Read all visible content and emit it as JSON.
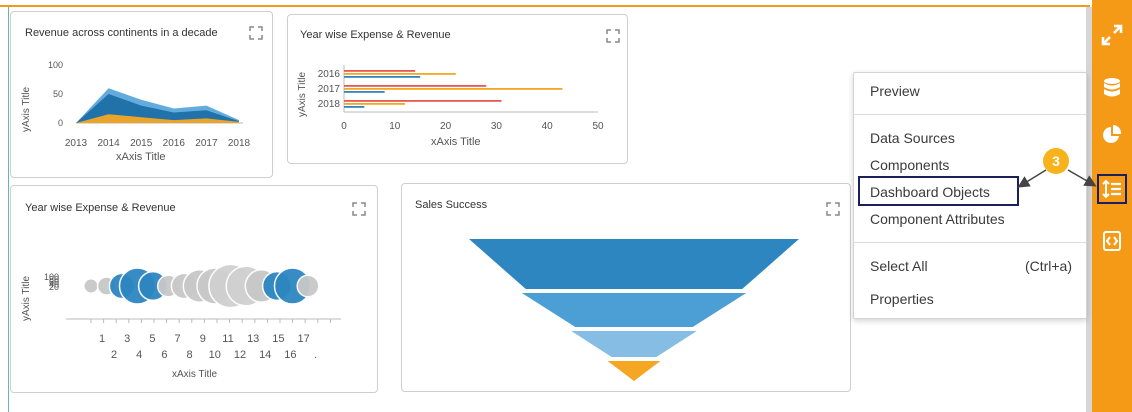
{
  "panels": {
    "revenue_continents": {
      "title": "Revenue across continents in a decade",
      "ylabel": "yAxis Title",
      "xlabel": "xAxis Title",
      "y_ticks": [
        "100",
        "50",
        "0"
      ],
      "x_ticks": [
        "2013",
        "2014",
        "2015",
        "2016",
        "2017",
        "2018"
      ]
    },
    "expense_revenue_bar": {
      "title": "Year wise Expense & Revenue",
      "ylabel": "yAxis Title",
      "xlabel": "xAxis Title",
      "y_ticks": [
        "2016",
        "2017",
        "2018"
      ],
      "x_ticks": [
        "0",
        "10",
        "20",
        "30",
        "40",
        "50"
      ]
    },
    "expense_revenue_bubble": {
      "title": "Year wise Expense & Revenue",
      "ylabel": "yAxis Title",
      "xlabel": "xAxis Title",
      "y_ticks": [
        "100",
        "80",
        "60",
        "40",
        "20"
      ],
      "x_ticks_top": [
        "1",
        "3",
        "5",
        "7",
        "9",
        "11",
        "13",
        "15",
        "17"
      ],
      "x_ticks_bottom": [
        "2",
        "4",
        "6",
        "8",
        "10",
        "12",
        "14",
        "16",
        "."
      ]
    },
    "sales_success": {
      "title": "Sales Success"
    }
  },
  "chart_data": [
    {
      "type": "area",
      "title": "Revenue across continents in a decade",
      "xlabel": "xAxis Title",
      "ylabel": "yAxis Title",
      "x": [
        2013,
        2014,
        2015,
        2016,
        2017,
        2018
      ],
      "ylim": [
        0,
        100
      ],
      "series": [
        {
          "values": [
            0,
            60,
            40,
            25,
            30,
            5
          ],
          "color": "#5aa6dd"
        },
        {
          "values": [
            0,
            50,
            30,
            18,
            22,
            3
          ],
          "color": "#1f6fa6"
        },
        {
          "values": [
            0,
            15,
            10,
            5,
            8,
            2
          ],
          "color": "#f5a623"
        }
      ]
    },
    {
      "type": "bar",
      "orientation": "horizontal",
      "title": "Year wise Expense & Revenue",
      "xlabel": "xAxis Title",
      "ylabel": "yAxis Title",
      "categories": [
        "2016",
        "2017",
        "2018"
      ],
      "xlim": [
        0,
        50
      ],
      "series": [
        {
          "values": [
            14,
            28,
            31
          ],
          "color": "#e8584f"
        },
        {
          "values": [
            22,
            43,
            12
          ],
          "color": "#f5a623"
        },
        {
          "values": [
            15,
            8,
            4
          ],
          "color": "#2e86c1"
        }
      ]
    },
    {
      "type": "scatter",
      "title": "Year wise Expense & Revenue",
      "xlabel": "xAxis Title",
      "ylabel": "yAxis Title",
      "ylim": [
        20,
        100
      ],
      "points": [
        {
          "x": 1,
          "y": 60,
          "size": 8,
          "color": "#c8c8c8"
        },
        {
          "x": 2,
          "y": 60,
          "size": 10,
          "color": "#c8c8c8"
        },
        {
          "x": 3,
          "y": 60,
          "size": 14,
          "color": "#2e86c1"
        },
        {
          "x": 4,
          "y": 60,
          "size": 20,
          "color": "#2e86c1"
        },
        {
          "x": 5,
          "y": 60,
          "size": 16,
          "color": "#2e86c1"
        },
        {
          "x": 6,
          "y": 60,
          "size": 12,
          "color": "#c8c8c8"
        },
        {
          "x": 7,
          "y": 60,
          "size": 14,
          "color": "#c8c8c8"
        },
        {
          "x": 8,
          "y": 60,
          "size": 18,
          "color": "#c8c8c8"
        },
        {
          "x": 9,
          "y": 60,
          "size": 20,
          "color": "#c8c8c8"
        },
        {
          "x": 10,
          "y": 60,
          "size": 24,
          "color": "#d0d0d0"
        },
        {
          "x": 11,
          "y": 60,
          "size": 22,
          "color": "#d0d0d0"
        },
        {
          "x": 12,
          "y": 60,
          "size": 18,
          "color": "#c8c8c8"
        },
        {
          "x": 13,
          "y": 60,
          "size": 16,
          "color": "#2e86c1"
        },
        {
          "x": 14,
          "y": 60,
          "size": 20,
          "color": "#2e86c1"
        },
        {
          "x": 15,
          "y": 60,
          "size": 12,
          "color": "#c8c8c8"
        }
      ]
    },
    {
      "type": "funnel",
      "title": "Sales Success",
      "stages": [
        {
          "value": 100,
          "color": "#2e86c1"
        },
        {
          "value": 68,
          "color": "#4c9fd4"
        },
        {
          "value": 38,
          "color": "#85bde4"
        },
        {
          "value": 16,
          "color": "#f5a623"
        }
      ]
    }
  ],
  "context_menu": {
    "items": [
      {
        "label": "Preview"
      },
      {
        "label": "Data Sources"
      },
      {
        "label": "Components"
      },
      {
        "label": "Dashboard Objects"
      },
      {
        "label": "Component Attributes"
      },
      {
        "label": "Select All",
        "shortcut": "(Ctrl+a)"
      },
      {
        "label": "Properties"
      }
    ]
  },
  "callout": {
    "number": "3"
  },
  "sidebar": {
    "icons": [
      "expand-icon",
      "database-icon",
      "pie-chart-icon",
      "dashboard-objects-icon",
      "script-icon"
    ],
    "color": "#f59a16"
  }
}
